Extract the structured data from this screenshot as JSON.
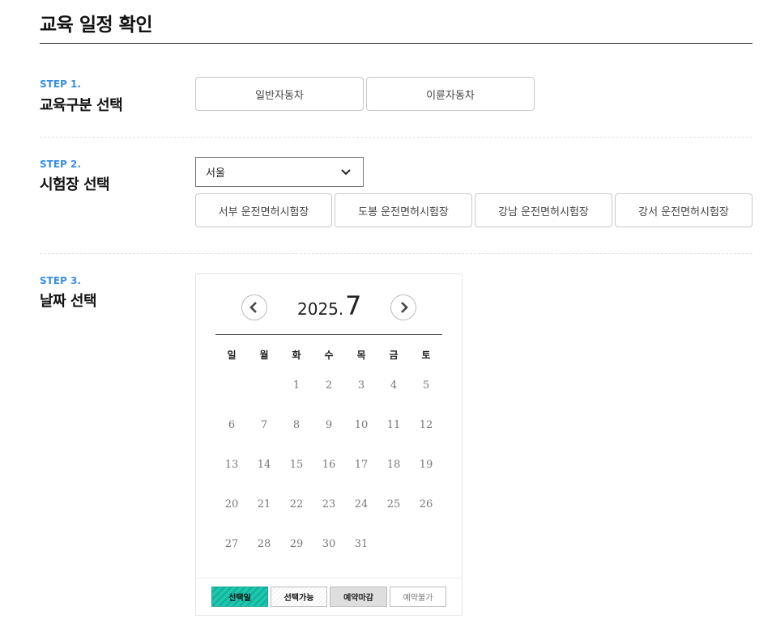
{
  "page": {
    "title": "교육 일정 확인"
  },
  "steps": [
    {
      "no": "STEP 1.",
      "name": "교육구분 선택",
      "options": [
        "일반자동차",
        "이륜자동차"
      ]
    },
    {
      "no": "STEP 2.",
      "name": "시험장 선택",
      "region": "서울",
      "options": [
        "서부 운전면허시험장",
        "도봉 운전면허시험장",
        "강남 운전면허시험장",
        "강서 운전면허시험장"
      ]
    },
    {
      "no": "STEP 3.",
      "name": "날짜 선택"
    }
  ],
  "calendar": {
    "year": "2025.",
    "month": "7",
    "weekdays": [
      "일",
      "월",
      "화",
      "수",
      "목",
      "금",
      "토"
    ],
    "first_weekday_index": 2,
    "days": [
      "1",
      "2",
      "3",
      "4",
      "5",
      "6",
      "7",
      "8",
      "9",
      "10",
      "11",
      "12",
      "13",
      "14",
      "15",
      "16",
      "17",
      "18",
      "19",
      "20",
      "21",
      "22",
      "23",
      "24",
      "25",
      "26",
      "27",
      "28",
      "29",
      "30",
      "31"
    ]
  },
  "legend": {
    "selected": "선택일",
    "available": "선택가능",
    "closed": "예약마감",
    "unavailable": "예약불가"
  },
  "colors": {
    "accent": "#3a8ee6",
    "selected": "#1fc9b0",
    "closed": "#dedede"
  },
  "icons": {
    "prev": "chevron-left-icon",
    "next": "chevron-right-icon",
    "dropdown": "chevron-down-icon"
  }
}
